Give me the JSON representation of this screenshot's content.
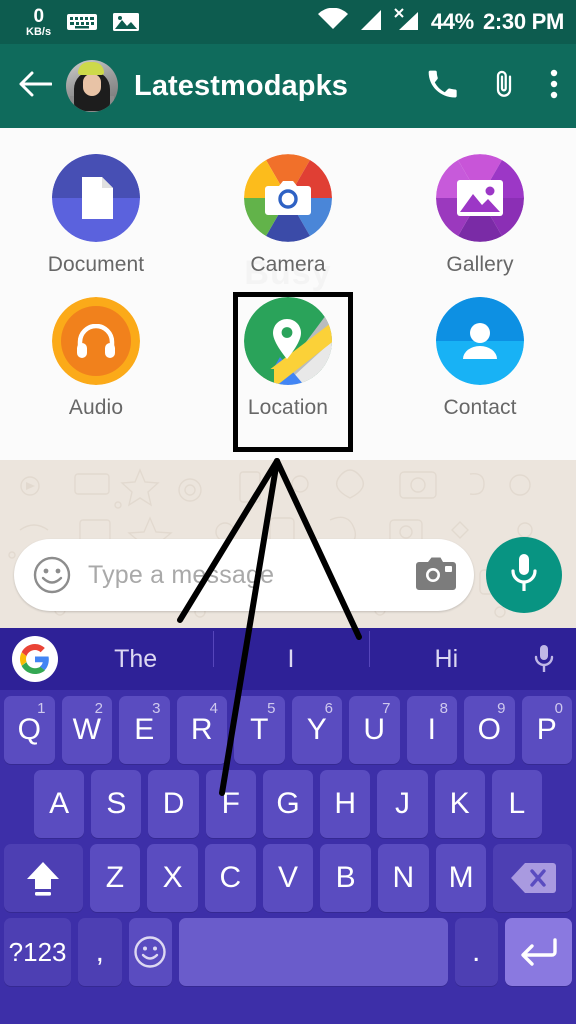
{
  "status_bar": {
    "net_speed_value": "0",
    "net_speed_unit": "KB/s",
    "keyboard_icon": "keyboard-icon",
    "image_icon": "image-icon",
    "wifi_icon": "wifi-icon",
    "signal_icon_1": "signal-bars-icon",
    "signal_icon_2": "signal-bars-no-sim-icon",
    "battery_percent": "44%",
    "clock": "2:30 PM"
  },
  "app_bar": {
    "back_icon": "back-arrow-icon",
    "avatar": "contact-avatar",
    "title": "Latestmodapks",
    "call_icon": "phone-call-icon",
    "attach_icon": "paperclip-attach-icon",
    "more_icon": "overflow-menu-icon"
  },
  "attachment_panel": {
    "watermark": "Busy",
    "items": [
      {
        "label": "Document",
        "icon": "document-icon",
        "selected": false
      },
      {
        "label": "Camera",
        "icon": "camera-icon",
        "selected": false
      },
      {
        "label": "Gallery",
        "icon": "gallery-icon",
        "selected": false
      },
      {
        "label": "Audio",
        "icon": "audio-headphones-icon",
        "selected": false
      },
      {
        "label": "Location",
        "icon": "location-map-pin-icon",
        "selected": true
      },
      {
        "label": "Contact",
        "icon": "contact-person-icon",
        "selected": false
      }
    ]
  },
  "composer": {
    "emoji_icon": "emoji-smiley-icon",
    "placeholder": "Type a message",
    "value": "",
    "camera_icon": "camera-icon",
    "mic_icon": "microphone-icon"
  },
  "keyboard": {
    "suggestions": [
      "The",
      "I",
      "Hi"
    ],
    "google_logo": "google-g-logo",
    "voice_icon": "microphone-icon",
    "row1": [
      {
        "label": "Q",
        "sup": "1"
      },
      {
        "label": "W",
        "sup": "2"
      },
      {
        "label": "E",
        "sup": "3"
      },
      {
        "label": "R",
        "sup": "4"
      },
      {
        "label": "T",
        "sup": "5"
      },
      {
        "label": "Y",
        "sup": "6"
      },
      {
        "label": "U",
        "sup": "7"
      },
      {
        "label": "I",
        "sup": "8"
      },
      {
        "label": "O",
        "sup": "9"
      },
      {
        "label": "P",
        "sup": "0"
      }
    ],
    "row2": [
      "A",
      "S",
      "D",
      "F",
      "G",
      "H",
      "J",
      "K",
      "L"
    ],
    "row3": [
      "Z",
      "X",
      "C",
      "V",
      "B",
      "N",
      "M"
    ],
    "shift_icon": "shift-caps-lock-icon",
    "backspace_icon": "backspace-delete-icon",
    "symbols_key": "?123",
    "comma_key": ",",
    "emoji_key_icon": "emoji-smiley-icon",
    "space_key": "",
    "period_key": ".",
    "enter_icon": "enter-return-icon"
  },
  "annotation": {
    "color": "#000000",
    "description": "three-pointer-arrow-lines-from-location-tile"
  },
  "colors": {
    "status_bar": "#0d5c4f",
    "app_bar": "#0f6b5c",
    "panel_bg": "#fbfbfb",
    "chat_bg": "#ece5dd",
    "mic_fab": "#089482",
    "keyboard_bg": "#3d2fa8",
    "suggest_bg": "#2e2197",
    "key_bg": "#5a4cc0",
    "enter_key": "#8a79e0"
  }
}
